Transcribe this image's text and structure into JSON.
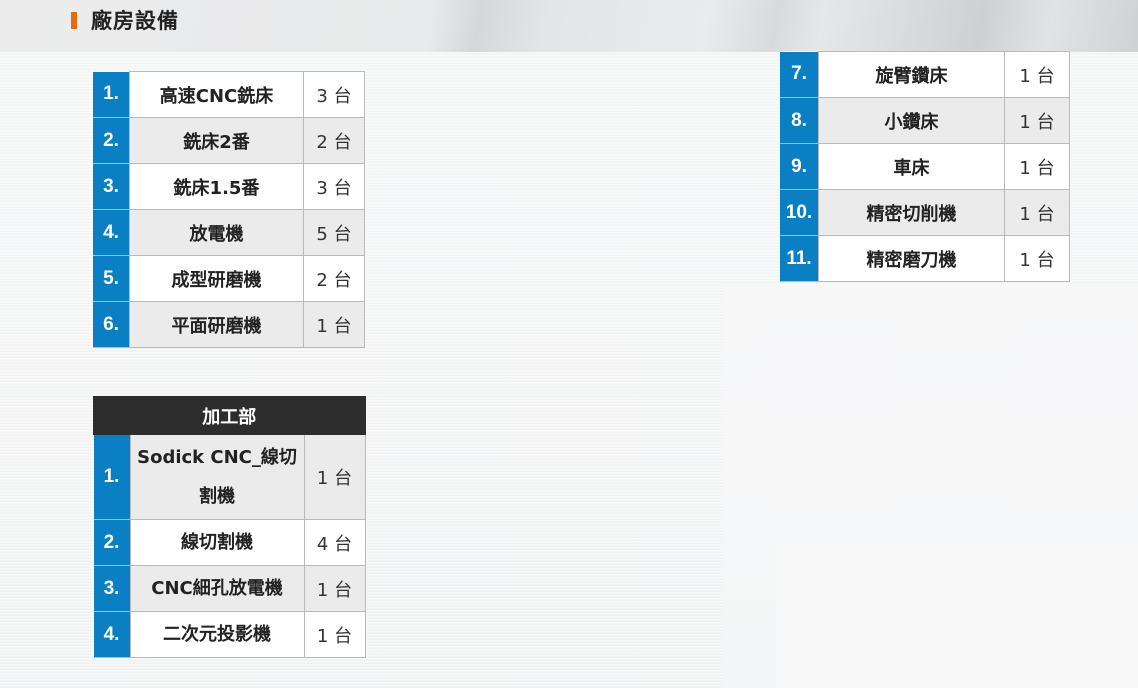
{
  "page": {
    "title": "廠房設備"
  },
  "table_left": {
    "rows": [
      {
        "num": "1.",
        "name": "高速CNC銑床",
        "qty": "3 台"
      },
      {
        "num": "2.",
        "name": "銑床2番",
        "qty": "2 台"
      },
      {
        "num": "3.",
        "name": "銑床1.5番",
        "qty": "3 台"
      },
      {
        "num": "4.",
        "name": "放電機",
        "qty": "5 台"
      },
      {
        "num": "5.",
        "name": "成型研磨機",
        "qty": "2 台"
      },
      {
        "num": "6.",
        "name": "平面研磨機",
        "qty": "1 台"
      }
    ]
  },
  "table_right": {
    "rows": [
      {
        "num": "7.",
        "name": "旋臂鑽床",
        "qty": "1 台"
      },
      {
        "num": "8.",
        "name": "小鑽床",
        "qty": "1 台"
      },
      {
        "num": "9.",
        "name": "車床",
        "qty": "1 台"
      },
      {
        "num": "10.",
        "name": "精密切削機",
        "qty": "1 台"
      },
      {
        "num": "11.",
        "name": "精密磨刀機",
        "qty": "1 台"
      }
    ]
  },
  "table_processing": {
    "header": "加工部",
    "rows": [
      {
        "num": "1.",
        "name": "Sodick CNC_線切割機",
        "qty": "1 台"
      },
      {
        "num": "2.",
        "name": "線切割機",
        "qty": "4 台"
      },
      {
        "num": "3.",
        "name": "CNC細孔放電機",
        "qty": "1 台"
      },
      {
        "num": "4.",
        "name": "二次元投影機",
        "qty": "1 台"
      }
    ]
  },
  "colors": {
    "accent": "#e66a12",
    "number_cell": "#0a7fc4",
    "header_dark": "#2d2d2d"
  }
}
